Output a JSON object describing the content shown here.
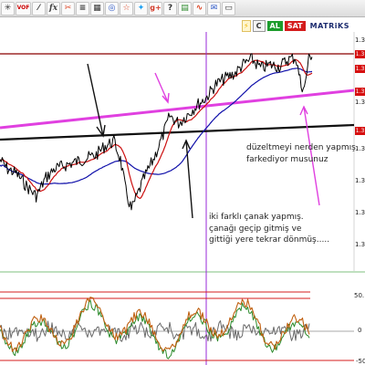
{
  "toolbar": {
    "buttons": [
      {
        "id": "chart",
        "icon": "chart-icon",
        "glyph": "✳"
      },
      {
        "id": "vof",
        "icon": "vof-logo-icon",
        "glyph": "VOF"
      },
      {
        "id": "line",
        "icon": "line-chart-icon",
        "glyph": "⁄"
      },
      {
        "id": "fx",
        "icon": "formula-icon",
        "glyph": "fx"
      },
      {
        "id": "scissors",
        "icon": "scissors-icon",
        "glyph": "✂"
      },
      {
        "id": "list",
        "icon": "list-icon",
        "glyph": "≡"
      },
      {
        "id": "calc",
        "icon": "calculator-icon",
        "glyph": "▦"
      },
      {
        "id": "target",
        "icon": "target-icon",
        "glyph": "◎"
      },
      {
        "id": "star",
        "icon": "star-icon",
        "glyph": "☆"
      },
      {
        "id": "twitter",
        "icon": "twitter-icon",
        "glyph": "✦"
      },
      {
        "id": "gplus",
        "icon": "google-plus-icon",
        "glyph": "g+"
      },
      {
        "id": "help",
        "icon": "help-icon",
        "glyph": "?"
      },
      {
        "id": "grid",
        "icon": "grid-icon",
        "glyph": "▤"
      },
      {
        "id": "wave",
        "icon": "wave-icon",
        "glyph": "∿"
      },
      {
        "id": "mail",
        "icon": "mail-icon",
        "glyph": "✉"
      },
      {
        "id": "window",
        "icon": "window-icon",
        "glyph": "▭"
      }
    ]
  },
  "status": {
    "bolt": "⚡",
    "c": "C",
    "al": "AL",
    "sat": "SAT",
    "matriks": "MATRiKS"
  },
  "price_axis": {
    "labels": [
      "1.3",
      "1.3",
      "1.3",
      "1.3",
      "1.3",
      "1.3",
      "1.3"
    ],
    "tags": [
      "1.3",
      "1.3",
      "1.3",
      "1.3"
    ]
  },
  "osc_axis": {
    "labels": [
      "50.",
      "0",
      "-50"
    ]
  },
  "annotations": {
    "note1": "düzeltmeyi nerden yapmış\nfarkediyor musunuz",
    "note2": "iki farklı çanak yapmış.\nçanağı geçip gitmiş ve\ngittiği yere tekrar dönmüş....."
  },
  "colors": {
    "price": "#000000",
    "ma_fast": "#cc1010",
    "ma_slow": "#1010aa",
    "trendline_magenta": "#e040e0",
    "trendline_black": "#111111",
    "resistance": "#8b0000",
    "osc_orange": "#c06010",
    "osc_green": "#2a8a2a",
    "osc_gray": "#6a6a6a",
    "vertical_cursor": "#9a2ad8"
  }
}
